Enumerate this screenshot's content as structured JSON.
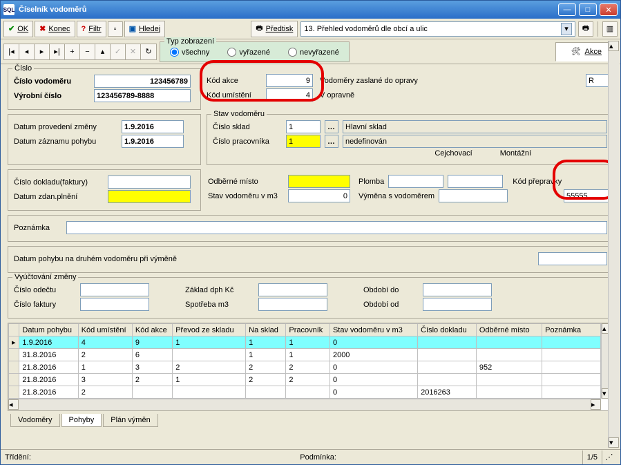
{
  "window": {
    "title": "Číselník vodoměrů"
  },
  "toolbar": {
    "ok": "OK",
    "konec": "Konec",
    "filtr": "Filtr",
    "hledej": "Hledej",
    "predtisk": "Předtisk",
    "report_selected": "13. Přehled vodoměrů dle obcí a ulic"
  },
  "typ": {
    "legend": "Typ zobrazení",
    "vsechny": "všechny",
    "vyrazene": "vyřazené",
    "nevyrazene": "nevyřazené"
  },
  "akce_btn": "Akce",
  "cislo": {
    "legend": "Číslo",
    "label_vodomer": "Číslo vodoměru",
    "val_vodomer": "123456789",
    "label_vyrobni": "Výrobní číslo",
    "val_vyrobni": "123456789-8888"
  },
  "kody": {
    "label_akce": "Kód akce",
    "val_akce": "9",
    "label_umisteni": "Kód umístění",
    "val_umisteni": "4",
    "zaslane": "Vodoměry zaslané do opravy",
    "zaslane_val": "R",
    "opravne": "V opravně"
  },
  "datumy": {
    "label_prov": "Datum provedení změny",
    "val_prov": "1.9.2016",
    "label_zaz": "Datum záznamu pohybu",
    "val_zaz": "1.9.2016"
  },
  "stav": {
    "legend": "Stav vodoměru",
    "label_sklad": "Číslo sklad",
    "val_sklad": "1",
    "sklad_nazev": "Hlavní sklad",
    "label_prac": "Číslo pracovníka",
    "val_prac": "1",
    "prac_nazev": "nedefinován",
    "cejch": "Cejchovací",
    "mont": "Montážní",
    "label_misto": "Odběrné místo",
    "plomba": "Plomba",
    "label_prepravka": "Kód přepravky",
    "prepravka": "55555",
    "label_stavm3": "Stav vodoměru v m3",
    "stavm3": "0",
    "label_vymena": "Výměna s vodoměrem"
  },
  "doklad": {
    "label": "Číslo dokladu(faktury)"
  },
  "zd": {
    "label": "Datum zdan.plnění"
  },
  "poznamka": {
    "label": "Poznámka"
  },
  "vymena2": {
    "label": "Datum pohybu na druhém vodoměru při výměně"
  },
  "vyuct": {
    "legend": "Vyúčtování změny",
    "odectu": "Číslo odečtu",
    "zaklad": "Základ dph Kč",
    "obdo": "Období do",
    "fakt": "Číslo faktury",
    "spotreba": "Spotřeba m3",
    "obod": "Období od"
  },
  "grid": {
    "cols": [
      "Datum pohybu",
      "Kód umístění",
      "Kód akce",
      "Převod ze skladu",
      "Na sklad",
      "Pracovník",
      "Stav vodoměru v m3",
      "Číslo dokladu",
      "Odběrné místo",
      "Poznámka"
    ],
    "rows": [
      {
        "d": "1.9.2016",
        "ku": "4",
        "ka": "9",
        "ps": "1",
        "ns": "1",
        "pr": "1",
        "st": "0",
        "cd": "",
        "om": "",
        "pz": "",
        "sel": true
      },
      {
        "d": "31.8.2016",
        "ku": "2",
        "ka": "6",
        "ps": "",
        "ns": "1",
        "pr": "1",
        "st": "2000",
        "cd": "",
        "om": "",
        "pz": ""
      },
      {
        "d": "21.8.2016",
        "ku": "1",
        "ka": "3",
        "ps": "2",
        "ns": "2",
        "pr": "2",
        "st": "0",
        "cd": "",
        "om": "952",
        "pz": ""
      },
      {
        "d": "21.8.2016",
        "ku": "3",
        "ka": "2",
        "ps": "1",
        "ns": "2",
        "pr": "2",
        "st": "0",
        "cd": "",
        "om": "",
        "pz": ""
      },
      {
        "d": "21.8.2016",
        "ku": "2",
        "ka": "",
        "ps": "",
        "ns": "",
        "pr": "",
        "st": "0",
        "cd": "2016263",
        "om": "",
        "pz": ""
      }
    ]
  },
  "tabs": {
    "vodomery": "Vodoměry",
    "pohyby": "Pohyby",
    "plan": "Plán výměn"
  },
  "status": {
    "trideni": "Třídění:",
    "podminka": "Podmínka:",
    "page": "1/5"
  }
}
